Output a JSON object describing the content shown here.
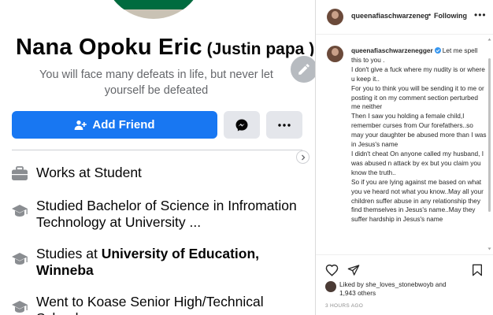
{
  "facebook": {
    "name": "Nana Opoku Eric",
    "nickname": "(Justin papa )",
    "bio": "You will face many defeats in life, but never let yourself be defeated",
    "add_friend_label": "Add Friend",
    "intro": [
      {
        "icon": "briefcase-icon",
        "text": "Works at Student",
        "bold": ""
      },
      {
        "icon": "graduation-cap-icon",
        "text": "Studied Bachelor of Science in Infromation Technology at University ...",
        "bold": ""
      },
      {
        "icon": "graduation-cap-icon",
        "text": "Studies at ",
        "bold": "University of Education, Winneba"
      },
      {
        "icon": "graduation-cap-icon",
        "text": "Went to Koase Senior High/Technical School",
        "bold": ""
      }
    ]
  },
  "instagram": {
    "username": "queenafiaschwarzenegger",
    "header_username": "queenafiaschwarzeneg",
    "follow_label": "Following",
    "separator": "•",
    "caption_lines": [
      "Let me spell this to you .",
      "I don't give a fuck where my nudity is or where u keep it..",
      "For you to think you will be sending it to me or posting it on my comment section perturbed me neither",
      "Then I saw you holding a female child,I remember curses from Our forefathers..so may your daughter be abused more than I was in Jesus's name",
      "I didn't cheat On anyone called my husband, I was abused n attack by ex but you claim you know the truth..",
      "So if you are lying against me based on what you ve heard not what you know..May all your children suffer abuse in any relationship they find themselves in Jesus's name..May they suffer hardship in Jesus's name"
    ],
    "liked_by_prefix": "Liked by ",
    "liked_by_user": "she_loves_stonebwoyb",
    "liked_by_and": " and",
    "liked_by_others": "1,943 others",
    "time": "3 HOURS AGO"
  },
  "colors": {
    "fb_blue": "#1877f2",
    "fb_grey_button": "#e4e6eb",
    "ig_verified": "#3897f0"
  }
}
